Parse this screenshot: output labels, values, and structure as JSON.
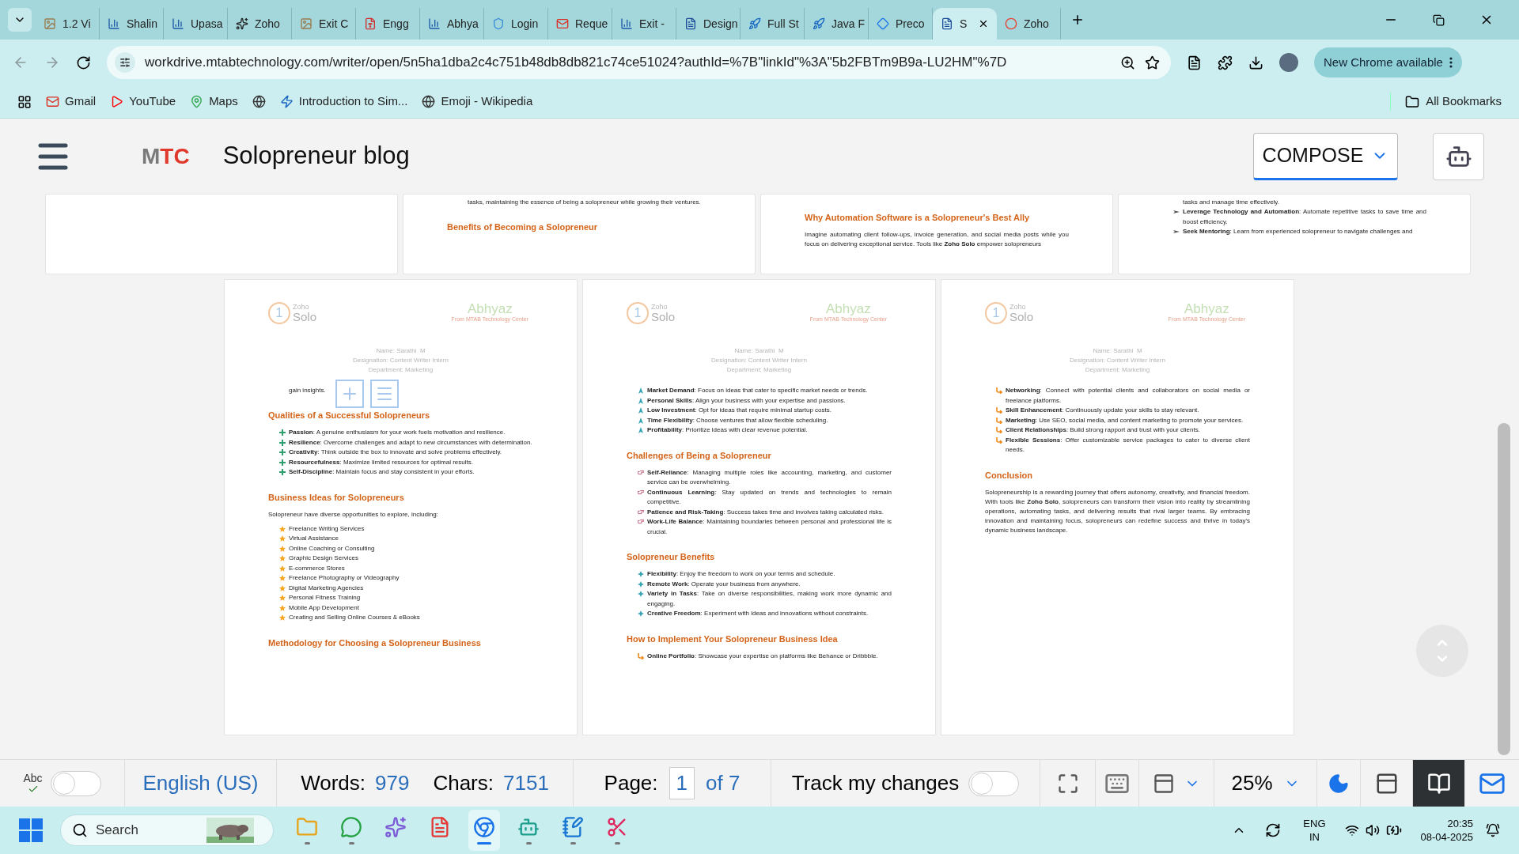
{
  "browser": {
    "tabs": [
      {
        "title": "1.2 Vi",
        "selected": false
      },
      {
        "title": "Shalin",
        "kind": "chart",
        "selected": false
      },
      {
        "title": "Upasa",
        "kind": "chart",
        "selected": false
      },
      {
        "title": "Zoho",
        "kind": "knot",
        "selected": false
      },
      {
        "title": "Exit C",
        "selected": false
      },
      {
        "title": "Engg",
        "kind": "pdf",
        "selected": false
      },
      {
        "title": "Abhya",
        "kind": "chart",
        "selected": false
      },
      {
        "title": "Login",
        "kind": "shield",
        "selected": false
      },
      {
        "title": "Reque",
        "kind": "mail",
        "selected": false
      },
      {
        "title": "Exit -",
        "kind": "chart",
        "selected": false
      },
      {
        "title": "Design",
        "kind": "doc",
        "selected": false
      },
      {
        "title": "Full St",
        "kind": "deploy",
        "selected": false
      },
      {
        "title": "Java F",
        "kind": "deploy",
        "selected": false
      },
      {
        "title": "Preco",
        "kind": "diamond",
        "selected": false
      },
      {
        "title": "S",
        "kind": "doc",
        "selected": true
      },
      {
        "title": "Zoho",
        "kind": "ring",
        "selected": false
      }
    ],
    "url": "workdrive.mtabtechnology.com/writer/open/5n5ha1dba2c4c751b48db8db821c74ce51024?authId=%7B\"linkId\"%3A\"5b2FBTm9B9a-LU2HM\"%7D",
    "update_button": "New Chrome available",
    "bookmarks": [
      {
        "label": "Gmail",
        "kind": "mail"
      },
      {
        "label": "YouTube",
        "kind": "play"
      },
      {
        "label": "Maps",
        "kind": "pin"
      },
      {
        "kind": "globe"
      },
      {
        "label": "Introduction to Sim...",
        "kind": "bolt"
      },
      {
        "label": "Emoji - Wikipedia",
        "kind": "globe"
      }
    ],
    "all_bookmarks": "All Bookmarks"
  },
  "app": {
    "logo": [
      {
        "text": "M",
        "color": "#7a7a7a"
      },
      {
        "text": "TC",
        "color": "#e0392b"
      }
    ],
    "title": "Solopreneur blog",
    "compose": "COMPOSE"
  },
  "top_pages": [
    {
      "blocks": [
        {
          "kind": "continuation",
          "text": "tasks, maintaining the essence of being a solopreneur while growing their ventures."
        },
        {
          "kind": "heading",
          "text": "Benefits of Becoming a Solopreneur"
        }
      ]
    },
    {
      "blocks": [
        {
          "kind": "heading",
          "text": "Why Automation Software is a Solopreneur's Best Ally"
        },
        {
          "kind": "paragraph",
          "text": "Imagine automating client follow-ups, invoice generation, and social media posts while you focus on delivering exceptional service. Tools like **Zoho Solo** empower solopreneurs"
        }
      ]
    },
    {
      "blocks": [
        {
          "kind": "continuation",
          "text": "tasks and manage time effectively."
        },
        {
          "kind": "plane_list",
          "items": [
            "**Leverage Technology and Automation**: Automate repetitive tasks to save time and boost efficiency.",
            "**Seek Mentoring**: Learn from experienced solopreneur to navigate challenges and"
          ]
        }
      ]
    }
  ],
  "pages": [
    {
      "logo": {
        "mark": "1",
        "top": "Zoho",
        "bottom": "Solo"
      },
      "brand": {
        "name": "Abhyaz",
        "tagline": "From MTAB Technology Center"
      },
      "author": [
        "Name: Sarathi  M",
        "Designation: Content Writer Intern",
        "Department: Marketing"
      ],
      "insert_tools": true,
      "blocks": [
        {
          "kind": "continuation",
          "text": "gain insights."
        },
        {
          "kind": "heading",
          "text": "Qualities of a Successful Solopreneurs"
        },
        {
          "kind": "plus_list",
          "items": [
            "**Passion**: A genuine enthusiasm for your work fuels motivation and resilience.",
            "**Resilience**: Overcome challenges and adapt to new circumstances with determination.",
            "**Creativity**: Think outside the box to innovate and solve problems effectively.",
            "**Resourcefulness**: Maximize limited resources for optimal results.",
            "**Self-Discipline**: Maintain focus and stay consistent in your efforts."
          ]
        },
        {
          "kind": "heading",
          "text": "Business Ideas for Solopreneurs"
        },
        {
          "kind": "paragraph",
          "text": "Solopreneur have diverse opportunities to explore, including:"
        },
        {
          "kind": "star_list",
          "items": [
            "Freelance Writing Services",
            "Virtual Assistance",
            "Online Coaching or Consulting",
            "Graphic Design Services",
            "E-commerce Stores",
            "Freelance Photography or Videography",
            "Digital Marketing Agencies",
            "Personal Fitness Training",
            "Mobile App Development",
            "Creating and Selling Online Courses & eBooks"
          ]
        },
        {
          "kind": "heading",
          "text": "Methodology for Choosing a Solopreneur Business"
        }
      ]
    },
    {
      "logo": {
        "mark": "1",
        "top": "Zoho",
        "bottom": "Solo"
      },
      "brand": {
        "name": "Abhyaz",
        "tagline": "From MTAB Technology Center"
      },
      "author": [
        "Name: Sarathi  M",
        "Designation: Content Writer Intern",
        "Department: Marketing"
      ],
      "insert_tools": false,
      "blocks": [
        {
          "kind": "arrow_list",
          "items": [
            "**Market Demand**: Focus on ideas that cater to specific market needs or trends.",
            "**Personal Skills**: Align your business with your expertise and passions.",
            "**Low Investment**: Opt for ideas that require minimal startup costs.",
            "**Time Flexibility**: Choose ventures that allow flexible scheduling.",
            "**Profitability**: Prioritize ideas with clear revenue potential."
          ]
        },
        {
          "kind": "heading",
          "text": "Challenges of Being a Solopreneur"
        },
        {
          "kind": "hand_list",
          "items": [
            "**Self-Reliance**: Managing multiple roles like accounting, marketing, and customer service can be overwhelming.",
            "**Continuous Learning**: Stay updated on trends and technologies to remain competitive.",
            "**Patience and Risk-Taking**: Success takes time and involves taking calculated risks.",
            "**Work-Life Balance**: Maintaining boundaries between personal and professional life is crucial."
          ]
        },
        {
          "kind": "heading",
          "text": "Solopreneur Benefits"
        },
        {
          "kind": "diamond_list",
          "items": [
            "**Flexibility**: Enjoy the freedom to work on your terms and schedule.",
            "**Remote Work**: Operate your business from anywhere.",
            "**Variety in Tasks**: Take on diverse responsibilities, making work more dynamic and engaging.",
            "**Creative Freedom**: Experiment with ideas and innovations without constraints."
          ]
        },
        {
          "kind": "heading",
          "text": "How to Implement Your Solopreneur Business Idea"
        },
        {
          "kind": "curve_list",
          "items": [
            "**Online Portfolio**: Showcase your expertise on platforms like Behance or Dribbble."
          ]
        }
      ]
    },
    {
      "logo": {
        "mark": "1",
        "top": "Zoho",
        "bottom": "Solo"
      },
      "brand": {
        "name": "Abhyaz",
        "tagline": "From MTAB Technology Center"
      },
      "author": [
        "Name: Sarathi  M",
        "Designation: Content Writer Intern",
        "Department: Marketing"
      ],
      "insert_tools": false,
      "blocks": [
        {
          "kind": "curve_list",
          "items": [
            "**Networking**: Connect with potential clients and collaborators on social media or freelance platforms.",
            "**Skill Enhancement**: Continuously update your skills to stay relevant.",
            "**Marketing**: Use SEO, social media, and content marketing to promote your services.",
            "**Client Relationships**: Build strong rapport and trust with your clients.",
            "**Flexible Sessions**: Offer customizable service packages to cater to diverse client needs."
          ]
        },
        {
          "kind": "heading",
          "text": "Conclusion"
        },
        {
          "kind": "paragraph",
          "text": "Solopreneurship is a rewarding journey that offers autonomy, creativity, and financial freedom. With tools like **Zoho Solo**, solopreneurs can transform their vision into reality by streamlining operations, automating tasks, and delivering results that rival larger teams. By embracing innovation and maintaining focus, solopreneurs can redefine success and thrive in today's dynamic business landscape."
        }
      ]
    }
  ],
  "status": {
    "spell_label": "Abc",
    "spell_on": false,
    "language": "English (US)",
    "words_label": "Words:",
    "words": "979",
    "chars_label": "Chars:",
    "chars": "7151",
    "page_label": "Page:",
    "page": "1",
    "page_total": "of 7",
    "track_label": "Track my changes",
    "track_on": false,
    "zoom": "25%",
    "views": [
      {
        "kind": "layout",
        "selected": false
      },
      {
        "kind": "book",
        "selected": true
      }
    ]
  },
  "taskbar": {
    "search_placeholder": "Search",
    "apps": [
      {
        "kind": "folder",
        "running": true,
        "active": false
      },
      {
        "kind": "chat",
        "running": true,
        "active": false
      },
      {
        "kind": "copilot",
        "running": false,
        "active": false
      },
      {
        "kind": "office",
        "running": false,
        "active": false
      },
      {
        "kind": "browser",
        "running": true,
        "active": true
      },
      {
        "kind": "bot",
        "running": true,
        "active": false
      },
      {
        "kind": "notepad",
        "running": true,
        "active": false
      },
      {
        "kind": "snip",
        "running": true,
        "active": false
      }
    ],
    "lang": "ENG",
    "region": "IN",
    "time": "20:35",
    "date": "08-04-2025"
  }
}
